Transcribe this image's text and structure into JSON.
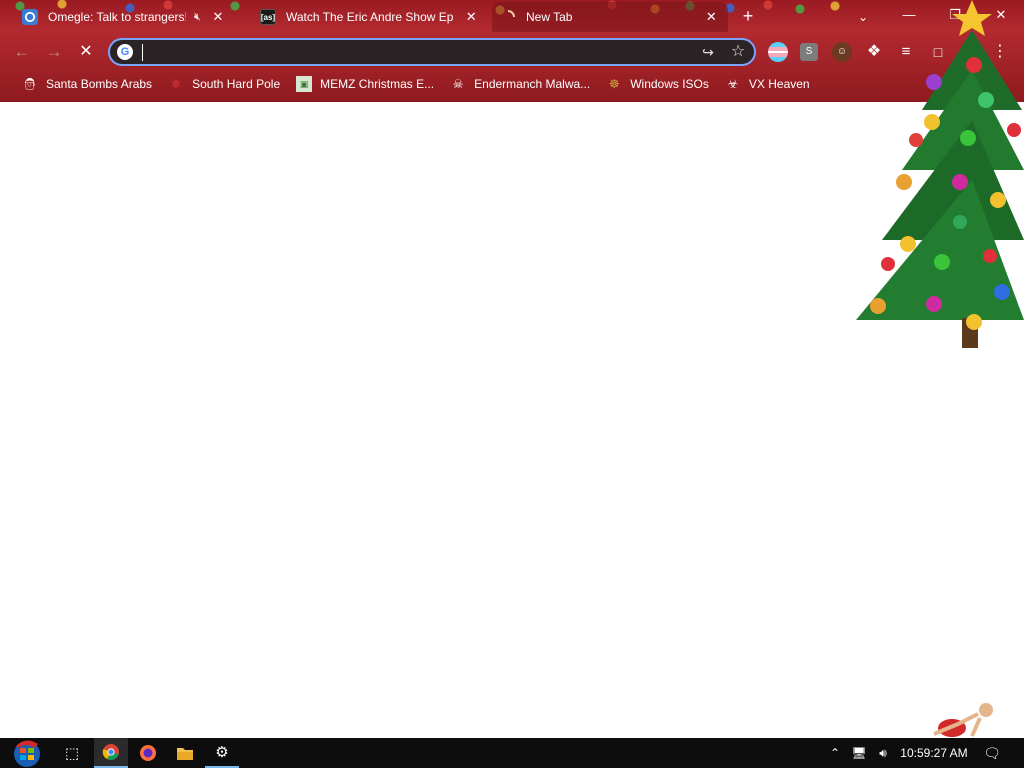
{
  "tabs": [
    {
      "title": "Omegle: Talk to strangers!",
      "favicon": "omegle-icon",
      "muted": true,
      "active": false
    },
    {
      "title": "Watch The Eric Andre Show Episo",
      "favicon": "adult-swim-icon",
      "favicon_text": "[as]",
      "active": false
    },
    {
      "title": "New Tab",
      "favicon": "loading-icon",
      "active": true
    }
  ],
  "toolbar": {
    "address_value": "",
    "address_placeholder": "",
    "loading": true
  },
  "bookmarks": [
    {
      "label": "Santa Bombs Arabs",
      "icon": "santa-icon"
    },
    {
      "label": "South Hard Pole",
      "icon": "snowflake-icon"
    },
    {
      "label": "MEMZ Christmas E...",
      "icon": "memz-icon"
    },
    {
      "label": "Endermanch Malwa...",
      "icon": "endermanch-icon"
    },
    {
      "label": "Windows ISOs",
      "icon": "buddha-icon"
    },
    {
      "label": "VX Heaven",
      "icon": "vx-heaven-icon"
    }
  ],
  "taskbar": {
    "clock": "10:59:27 AM",
    "apps": [
      "task-view",
      "chrome",
      "firefox",
      "file-explorer",
      "settings"
    ]
  },
  "colors": {
    "chrome_red": "#9a1a22",
    "omnibox_bg": "#2a2426",
    "omnibox_focus": "#7aa5ff",
    "taskbar_bg": "#0d0d0d",
    "taskbar_accent": "#76b9ed"
  }
}
